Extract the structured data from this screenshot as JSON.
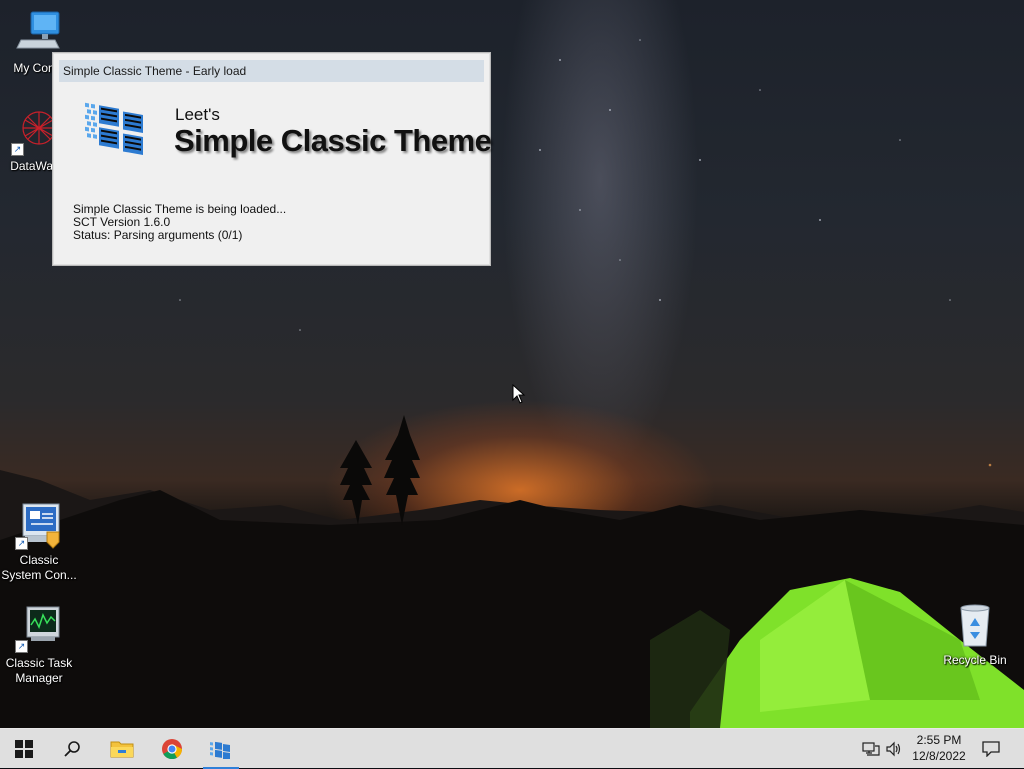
{
  "desktop": {
    "icons_left": [
      {
        "label": "My Comp",
        "icon": "computer-icon"
      },
      {
        "label": "DataWag",
        "icon": "datawag-icon"
      },
      {
        "label": "Classic System Con...",
        "icon": "control-panel-icon"
      },
      {
        "label": "Classic Task Manager",
        "icon": "task-manager-icon"
      }
    ],
    "icons_right": [
      {
        "label": "Recycle Bin",
        "icon": "recycle-bin-icon"
      }
    ]
  },
  "splash": {
    "title": "Simple Classic Theme - Early load",
    "logo_small": "Leet's",
    "logo_large": "Simple Classic Theme",
    "status_lines": [
      "Simple Classic Theme is being loaded...",
      "SCT Version 1.6.0",
      "Status: Parsing arguments (0/1)"
    ]
  },
  "taskbar": {
    "buttons": [
      {
        "icon": "windows-start-icon"
      },
      {
        "icon": "search-icon"
      },
      {
        "icon": "file-explorer-icon"
      },
      {
        "icon": "chrome-icon"
      },
      {
        "icon": "simple-classic-theme-icon",
        "active": true
      }
    ],
    "tray": {
      "network_icon": "network-icon",
      "volume_icon": "volume-icon",
      "time": "2:55 PM",
      "date": "12/8/2022",
      "notification_icon": "notification-icon"
    },
    "accent_color": "#2f7fd8"
  }
}
